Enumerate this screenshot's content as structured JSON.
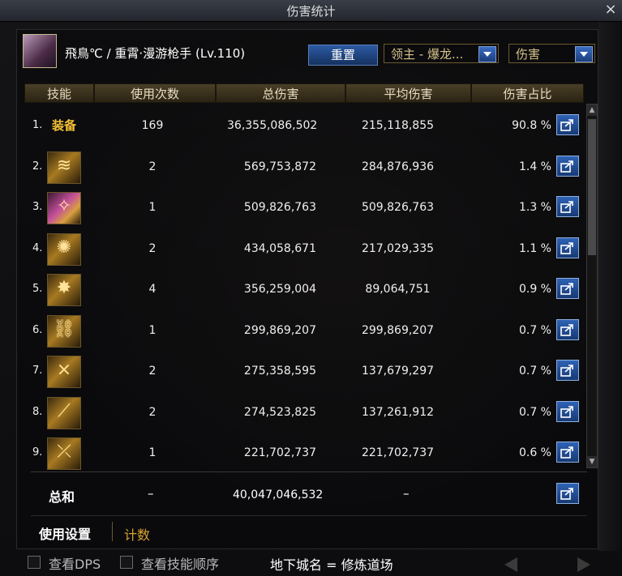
{
  "window": {
    "title": "伤害统计",
    "close_label": "×"
  },
  "character": {
    "name": "飛鳥℃ / 重霄·漫游枪手 (Lv.110)"
  },
  "controls": {
    "reset_label": "重置",
    "target_select": "领主 - 爆龙...",
    "mode_select": "伤害"
  },
  "table": {
    "headers": [
      "技能",
      "使用次数",
      "总伤害",
      "平均伤害",
      "伤害占比"
    ],
    "rows": [
      {
        "rank": "1.",
        "skill": "装备",
        "icon": "equipment-text",
        "uses": "169",
        "total": "36,355,086,502",
        "avg": "215,118,855",
        "pct": "90.8 %"
      },
      {
        "rank": "2.",
        "skill": "",
        "icon": "skill-icon-2",
        "uses": "2",
        "total": "569,753,872",
        "avg": "284,876,936",
        "pct": "1.4 %"
      },
      {
        "rank": "3.",
        "skill": "",
        "icon": "skill-icon-3",
        "uses": "1",
        "total": "509,826,763",
        "avg": "509,826,763",
        "pct": "1.3 %"
      },
      {
        "rank": "4.",
        "skill": "",
        "icon": "skill-icon-4",
        "uses": "2",
        "total": "434,058,671",
        "avg": "217,029,335",
        "pct": "1.1 %"
      },
      {
        "rank": "5.",
        "skill": "",
        "icon": "skill-icon-5",
        "uses": "4",
        "total": "356,259,004",
        "avg": "89,064,751",
        "pct": "0.9 %"
      },
      {
        "rank": "6.",
        "skill": "",
        "icon": "skill-icon-6",
        "uses": "1",
        "total": "299,869,207",
        "avg": "299,869,207",
        "pct": "0.7 %"
      },
      {
        "rank": "7.",
        "skill": "",
        "icon": "skill-icon-7",
        "uses": "2",
        "total": "275,358,595",
        "avg": "137,679,297",
        "pct": "0.7 %"
      },
      {
        "rank": "8.",
        "skill": "",
        "icon": "skill-icon-8",
        "uses": "2",
        "total": "274,523,825",
        "avg": "137,261,912",
        "pct": "0.7 %"
      },
      {
        "rank": "9.",
        "skill": "",
        "icon": "skill-icon-9",
        "uses": "1",
        "total": "221,702,737",
        "avg": "221,702,737",
        "pct": "0.6 %"
      }
    ],
    "summary": {
      "label": "总和",
      "uses": "–",
      "total": "40,047,046,532",
      "avg": "–"
    }
  },
  "tabs": {
    "settings": "使用设置",
    "count": "计数"
  },
  "footer": {
    "view_dps": "查看DPS",
    "view_order": "查看技能顺序",
    "dungeon": "地下城名 = 修炼道场"
  },
  "colors": {
    "gold": "#d8a530",
    "button_blue": "#2f62b5",
    "header_bg": "#4a3f27"
  }
}
